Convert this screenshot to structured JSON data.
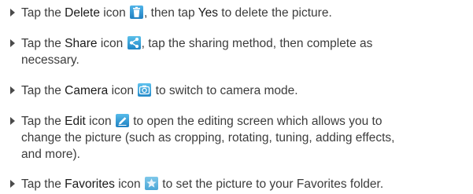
{
  "items": [
    {
      "pre": "Tap the ",
      "keyword": "Delete",
      "mid": " icon ",
      "icon": "trash-icon",
      "post_a": ", then tap ",
      "keyword2": "Yes",
      "post_b": " to delete the picture."
    },
    {
      "pre": "Tap the ",
      "keyword": "Share",
      "mid": " icon ",
      "icon": "share-icon",
      "line1_rest": ", tap the sharing method, then complete as",
      "line2": "necessary."
    },
    {
      "pre": "Tap the ",
      "keyword": "Camera",
      "mid": " icon ",
      "icon": "camera-icon",
      "post": " to switch to camera mode."
    },
    {
      "pre": "Tap the ",
      "keyword": "Edit",
      "mid": " icon ",
      "icon": "pencil-icon",
      "line1_rest": " to open the editing screen which allows you to",
      "line2": "change the picture (such as cropping, rotating, tuning, adding effects,",
      "line3": "and more)."
    },
    {
      "pre": "Tap the ",
      "keyword": "Favorites",
      "mid": " icon ",
      "icon": "star-icon",
      "post": " to set the picture to your Favorites folder."
    }
  ]
}
